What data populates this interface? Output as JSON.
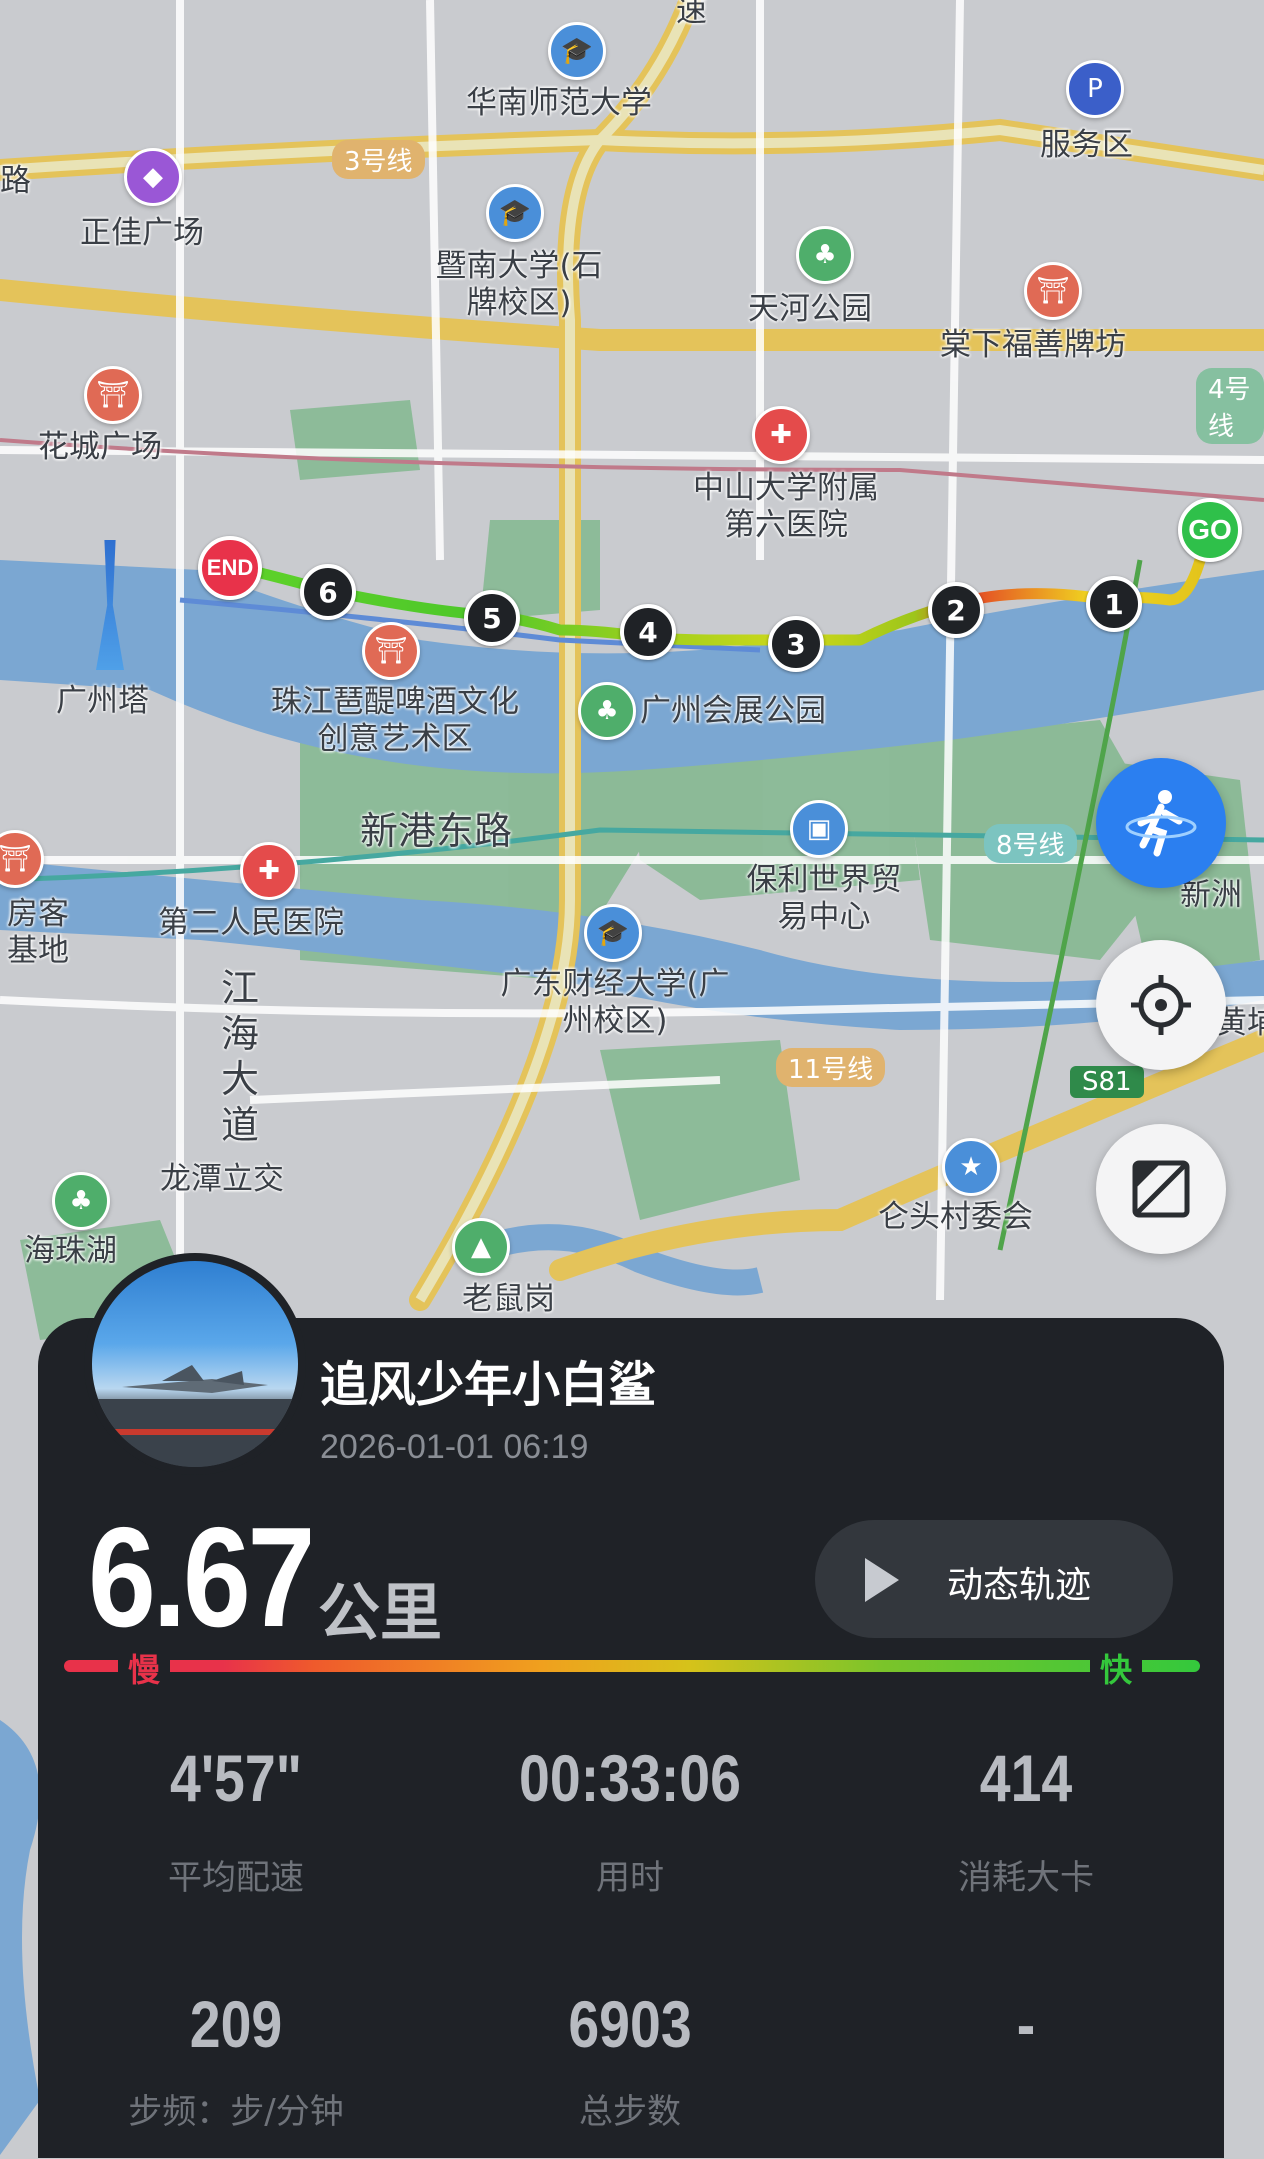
{
  "map": {
    "places": {
      "south_china_normal_univ": "华南师范大学",
      "service_area": "服务区",
      "zhengjia_plaza": "正佳广场",
      "jinan_univ": "暨南大学(石牌校区)",
      "tianhe_park": "天河公园",
      "tangxia": "棠下福善牌坊",
      "huacheng_square": "花城广场",
      "sysu_hospital": "中山大学附属第六医院",
      "canton_tower": "广州塔",
      "beer_culture": "珠江琶醍啤酒文化创意艺术区",
      "expo_park": "广州会展公园",
      "xingang_road": "新港东路",
      "poly_world_trade": "保利世界贸易中心",
      "xinzhou": "新洲",
      "second_hospital": "第二人民医院",
      "fangke_base": "房客基地",
      "jianghai_ave": "江海大道",
      "gdufe": "广东财经大学(广州校区)",
      "huangpu": "黄埔",
      "longtan": "龙潭立交",
      "haizhu_lake": "海珠湖",
      "cangtou": "仑头村委会",
      "laoshugang": "老鼠岗",
      "road_left": "路",
      "speed_char": "速"
    },
    "line_tags": {
      "line3": "3号线",
      "line4": "4号线",
      "line8": "8号线",
      "line11": "11号线",
      "s81": "S81"
    },
    "route": {
      "start_label": "GO",
      "end_label": "END",
      "km_markers": [
        "1",
        "2",
        "3",
        "4",
        "5",
        "6"
      ]
    }
  },
  "buttons": {
    "sport_mode": "running-figure-icon",
    "locate": "crosshair-icon",
    "toggle_map": "map-layer-icon"
  },
  "card": {
    "username": "追风少年小白鲨",
    "datetime": "2026-01-01 06:19",
    "distance": "6.67",
    "distance_unit": "公里",
    "replay_label": "动态轨迹",
    "speed_legend": {
      "slow": "慢",
      "fast": "快"
    },
    "stats": [
      {
        "value": "4'57\"",
        "label": "平均配速"
      },
      {
        "value": "00:33:06",
        "label": "用时"
      },
      {
        "value": "414",
        "label": "消耗大卡"
      },
      {
        "value": "209",
        "label": "步频：步/分钟"
      },
      {
        "value": "6903",
        "label": "总步数"
      },
      {
        "value": "-",
        "label": ""
      }
    ]
  },
  "colors": {
    "card_bg": "#1f2227",
    "slow": "#e8324a",
    "fast": "#34c83c",
    "sport_button": "#2b7ff0",
    "river": "#7aa4cf",
    "park": "#7fb88c"
  }
}
